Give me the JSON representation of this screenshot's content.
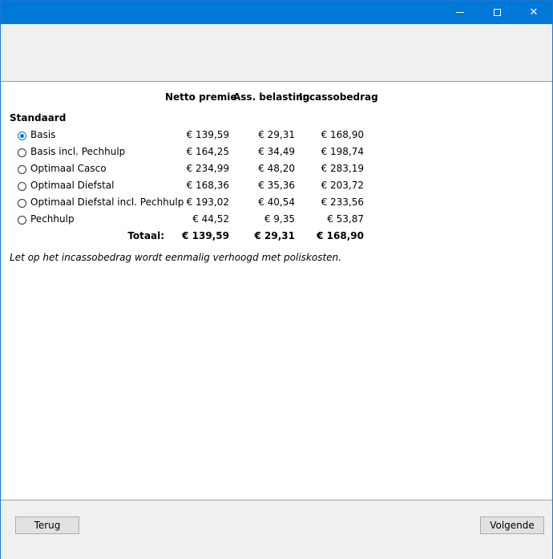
{
  "window": {
    "controls": {
      "minimize_icon": "minimize-icon",
      "maximize_icon": "maximize-icon",
      "close_icon": "close-icon",
      "close_glyph": "✕"
    }
  },
  "table": {
    "headers": [
      "Netto premie",
      "Ass. belasting",
      "Incassobedrag"
    ],
    "group_title": "Standaard",
    "rows": [
      {
        "label": "Basis",
        "netto": "€ 139,59",
        "belasting": "€ 29,31",
        "incasso": "€ 168,90",
        "selected": true
      },
      {
        "label": "Basis incl. Pechhulp",
        "netto": "€ 164,25",
        "belasting": "€ 34,49",
        "incasso": "€ 198,74",
        "selected": false
      },
      {
        "label": "Optimaal Casco",
        "netto": "€ 234,99",
        "belasting": "€ 48,20",
        "incasso": "€ 283,19",
        "selected": false
      },
      {
        "label": "Optimaal Diefstal",
        "netto": "€ 168,36",
        "belasting": "€ 35,36",
        "incasso": "€ 203,72",
        "selected": false
      },
      {
        "label": "Optimaal Diefstal incl. Pechhulp",
        "netto": "€ 193,02",
        "belasting": "€ 40,54",
        "incasso": "€ 233,56",
        "selected": false
      },
      {
        "label": "Pechhulp",
        "netto": "€ 44,52",
        "belasting": "€ 9,35",
        "incasso": "€ 53,87",
        "selected": false
      }
    ],
    "total": {
      "label": "Totaal:",
      "netto": "€ 139,59",
      "belasting": "€ 29,31",
      "incasso": "€ 168,90"
    }
  },
  "note": "Let op het incassobedrag wordt eenmalig verhoogd met poliskosten.",
  "footer": {
    "back_label": "Terug",
    "next_label": "Volgende"
  },
  "colors": {
    "titlebar": "#0078d7",
    "panel": "#f0f0f0",
    "radio_accent": "#0078d7"
  }
}
